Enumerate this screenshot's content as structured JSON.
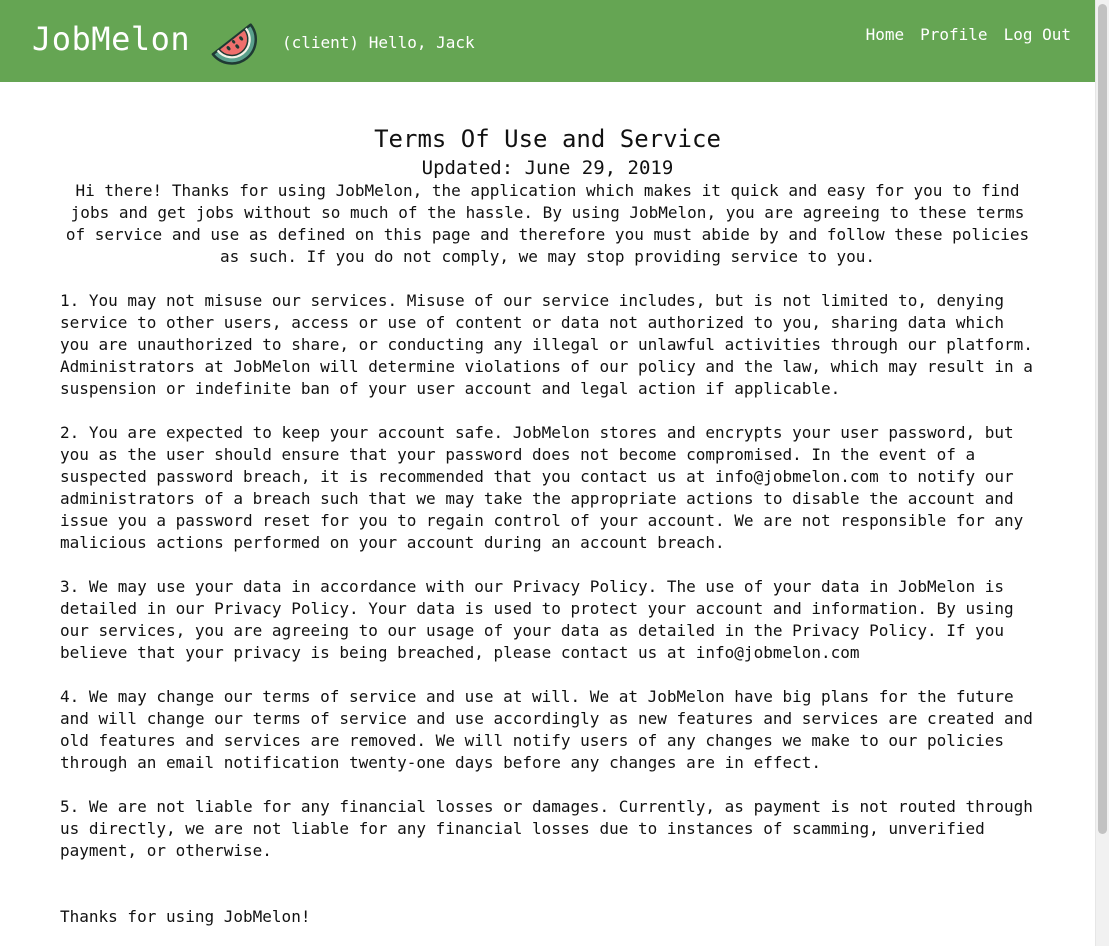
{
  "header": {
    "brand": "JobMelon",
    "logo_icon": "watermelon-icon",
    "greeting": "(client) Hello, Jack",
    "nav": [
      {
        "label": "Home"
      },
      {
        "label": "Profile"
      },
      {
        "label": "Log Out"
      }
    ],
    "background_color": "#65a553"
  },
  "main": {
    "title": "Terms Of Use and Service",
    "updated": "Updated: June 29, 2019",
    "intro": "Hi there! Thanks for using JobMelon, the application which makes it quick and easy for you to find\njobs and get jobs without so much of the hassle. By using JobMelon, you are agreeing to these terms\nof service and use as defined on this page and therefore you must abide by and follow these policies\nas such. If you do not comply, we may stop providing service to you.",
    "clauses": [
      "1. You may not misuse our services. Misuse of our service includes, but is not limited to, denying\nservice to other users, access or use of content or data not authorized to you, sharing data which\nyou are unauthorized to share, or conducting any illegal or unlawful activities through our platform.\nAdministrators at JobMelon will determine violations of our policy and the law, which may result in a\nsuspension or indefinite ban of your user account and legal action if applicable.",
      "2. You are expected to keep your account safe. JobMelon stores and encrypts your user password, but\nyou as the user should ensure that your password does not become compromised. In the event of a\nsuspected password breach, it is recommended that you contact us at info@jobmelon.com to notify our\nadministrators of a breach such that we may take the appropriate actions to disable the account and\nissue you a password reset for you to regain control of your account. We are not responsible for any\nmalicious actions performed on your account during an account breach.",
      "3. We may use your data in accordance with our Privacy Policy. The use of your data in JobMelon is\ndetailed in our Privacy Policy. Your data is used to protect your account and information. By using\nour services, you are agreeing to our usage of your data as detailed in the Privacy Policy. If you\nbelieve that your privacy is being breached, please contact us at info@jobmelon.com",
      "4. We may change our terms of service and use at will. We at JobMelon have big plans for the future\nand will change our terms of service and use accordingly as new features and services are created and\nold features and services are removed. We will notify users of any changes we make to our policies\nthrough an email notification twenty-one days before any changes are in effect.",
      "5. We are not liable for any financial losses or damages. Currently, as payment is not routed through\nus directly, we are not liable for any financial losses due to instances of scamming, unverified\npayment, or otherwise."
    ],
    "closing": "Thanks for using JobMelon!"
  }
}
